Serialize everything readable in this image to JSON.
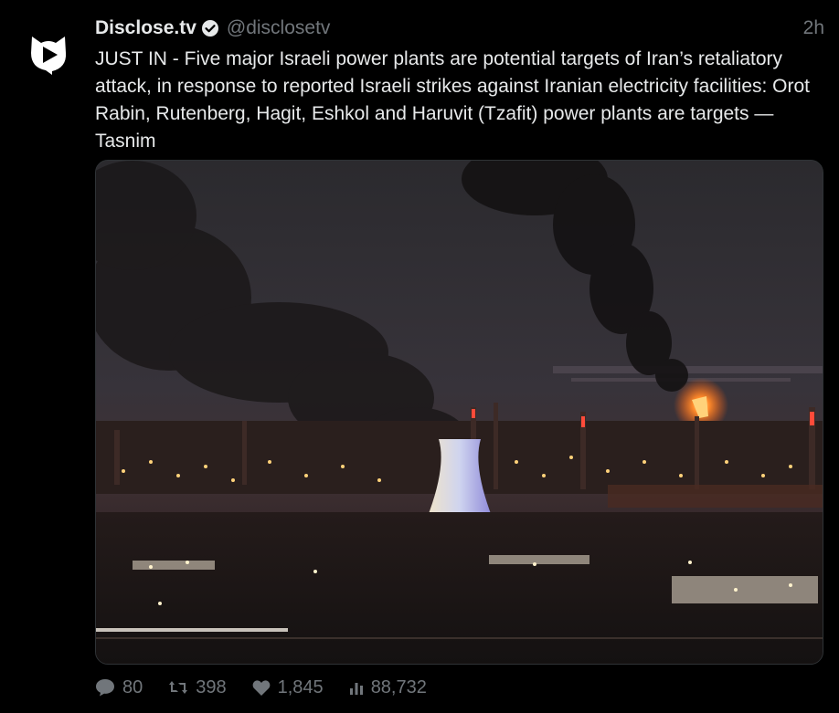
{
  "account": {
    "display_name": "Disclose.tv",
    "handle": "@disclosetv",
    "verified_icon": "verified-badge-icon",
    "avatar_icon": "disclose-tv-logo-icon"
  },
  "tweet": {
    "timestamp": "2h",
    "text": "JUST IN - Five major Israeli power plants are potential targets of Iran’s retaliatory attack, in response to reported Israeli strikes against Iranian electricity facilities: Orot Rabin, Rutenberg, Hagit, Eshkol and Haruvit (Tzafit) power plants are targets — Tasnim",
    "media_icon": "photo-industrial-power-plant-smoke"
  },
  "stats": {
    "replies": "80",
    "retweets": "398",
    "likes": "1,845",
    "views": "88,732"
  },
  "icons": {
    "reply": "reply-icon",
    "retweet": "retweet-icon",
    "like": "heart-icon",
    "views": "views-icon"
  },
  "colors": {
    "background": "#000000",
    "text": "#e7e9ea",
    "muted": "#71767b",
    "flame": "#ff7a22"
  }
}
